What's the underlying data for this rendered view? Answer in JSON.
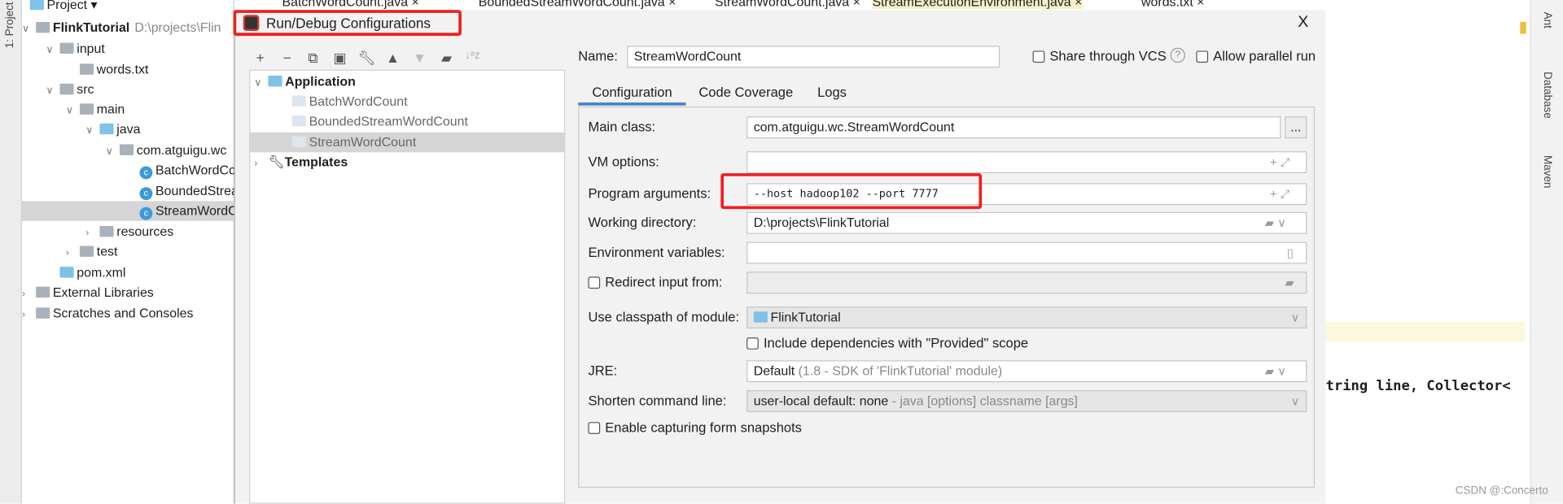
{
  "left_strip": {
    "label": "1: Project"
  },
  "project_panel": {
    "header": "Project",
    "tree": [
      {
        "label": "FlinkTutorial",
        "path": "D:\\projects\\Flin",
        "depth": 0,
        "icon": "module-folder-icon",
        "expanded": true
      },
      {
        "label": "input",
        "depth": 1,
        "icon": "folder-icon",
        "expanded": true
      },
      {
        "label": "words.txt",
        "depth": 2,
        "icon": "text-file-icon"
      },
      {
        "label": "src",
        "depth": 1,
        "icon": "folder-icon",
        "expanded": true
      },
      {
        "label": "main",
        "depth": 2,
        "icon": "folder-icon",
        "expanded": true
      },
      {
        "label": "java",
        "depth": 3,
        "icon": "source-folder-icon",
        "expanded": true
      },
      {
        "label": "com.atguigu.wc",
        "depth": 4,
        "icon": "package-icon",
        "expanded": true
      },
      {
        "label": "BatchWordCount",
        "depth": 5,
        "icon": "class-icon"
      },
      {
        "label": "BoundedStreamWordCount",
        "depth": 5,
        "icon": "class-icon"
      },
      {
        "label": "StreamWordCount",
        "depth": 5,
        "icon": "class-icon",
        "selected": true
      },
      {
        "label": "resources",
        "depth": 3,
        "icon": "resources-folder-icon",
        "expanded": false
      },
      {
        "label": "test",
        "depth": 2,
        "icon": "folder-icon",
        "expanded": false
      },
      {
        "label": "pom.xml",
        "depth": 1,
        "icon": "maven-icon"
      },
      {
        "label": "External Libraries",
        "depth": 0,
        "icon": "libraries-icon",
        "expanded": false
      },
      {
        "label": "Scratches and Consoles",
        "depth": 0,
        "icon": "scratches-icon",
        "expanded": false
      }
    ]
  },
  "editor_tabs": [
    {
      "label": "BatchWordCount.java"
    },
    {
      "label": "BoundedStreamWordCount.java"
    },
    {
      "label": "StreamWordCount.java"
    },
    {
      "label": "StreamExecutionEnvironment.java",
      "highlight": "#f5f0c8"
    },
    {
      "label": "words.txt"
    }
  ],
  "dialog": {
    "title": "Run/Debug Configurations",
    "close": "X",
    "toolbar": [
      "add-icon",
      "remove-icon",
      "copy-icon",
      "save-icon",
      "wrench-icon",
      "move-up-icon",
      "move-down-icon",
      "new-folder-icon",
      "sort-icon"
    ],
    "tree": {
      "application": "Application",
      "items": [
        "BatchWordCount",
        "BoundedStreamWordCount",
        "StreamWordCount"
      ],
      "selected": "StreamWordCount",
      "templates": "Templates"
    },
    "name_label": "Name:",
    "name_value": "StreamWordCount",
    "share_vcs": "Share through VCS",
    "help": "?",
    "allow_parallel": "Allow parallel run",
    "tabs": [
      "Configuration",
      "Code Coverage",
      "Logs"
    ],
    "active_tab": "Configuration",
    "form": {
      "main_class_label": "Main class:",
      "main_class": "com.atguigu.wc.StreamWordCount",
      "browse": "...",
      "vm_options_label": "VM options:",
      "vm_options": "",
      "program_args_label": "Program arguments:",
      "program_args": "--host hadoop102 --port 7777",
      "working_dir_label": "Working directory:",
      "working_dir": "D:\\projects\\FlinkTutorial",
      "env_vars_label": "Environment variables:",
      "env_vars": "",
      "redirect_label": "Redirect input from:",
      "classpath_label": "Use classpath of module:",
      "classpath": "FlinkTutorial",
      "include_deps": "Include dependencies with \"Provided\" scope",
      "jre_label": "JRE:",
      "jre": "Default",
      "jre_hint": "(1.8 - SDK of 'FlinkTutorial' module)",
      "shorten_label": "Shorten command line:",
      "shorten": "user-local default: none",
      "shorten_hint": "- java [options] classname [args]",
      "enable_snapshots": "Enable capturing form snapshots"
    }
  },
  "editor": {
    "code_fragment": "tring line, Collector<"
  },
  "right_strip": [
    "Ant",
    "Database",
    "Maven"
  ],
  "watermark": "CSDN @:Concerto",
  "colors": {
    "highlight_box": "#f01e1e",
    "tab_underline": "#4083c9",
    "selection": "#d5d5d5"
  }
}
